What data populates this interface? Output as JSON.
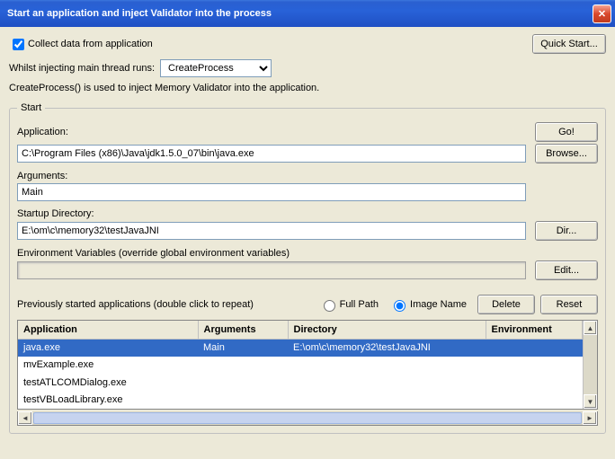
{
  "window_title": "Start an application and inject Validator into the process",
  "collect_label": "Collect data from application",
  "collect_checked": true,
  "quick_start": "Quick Start...",
  "inject_label": "Whilst injecting main thread runs:",
  "inject_value": "CreateProcess",
  "description": "CreateProcess() is used to inject Memory Validator into the application.",
  "start_legend": "Start",
  "go": "Go!",
  "app_label": "Application:",
  "app_value": "C:\\Program Files (x86)\\Java\\jdk1.5.0_07\\bin\\java.exe",
  "browse": "Browse...",
  "args_label": "Arguments:",
  "args_value": "Main",
  "startup_label": "Startup Directory:",
  "startup_value": "E:\\om\\c\\memory32\\testJavaJNI",
  "dir": "Dir...",
  "env_label": "Environment Variables (override global environment variables)",
  "edit": "Edit...",
  "prev_label": "Previously started applications (double click to repeat)",
  "fullpath": "Full Path",
  "imagename": "Image Name",
  "delete": "Delete",
  "reset": "Reset",
  "cols": {
    "app": "Application",
    "args": "Arguments",
    "dir": "Directory",
    "env": "Environment"
  },
  "rows": [
    {
      "app": "java.exe",
      "args": "Main",
      "dir": "E:\\om\\c\\memory32\\testJavaJNI",
      "env": ""
    },
    {
      "app": "mvExample.exe",
      "args": "",
      "dir": "",
      "env": ""
    },
    {
      "app": "testATLCOMDialog.exe",
      "args": "",
      "dir": "",
      "env": ""
    },
    {
      "app": "testVBLoadLibrary.exe",
      "args": "",
      "dir": "",
      "env": ""
    }
  ]
}
